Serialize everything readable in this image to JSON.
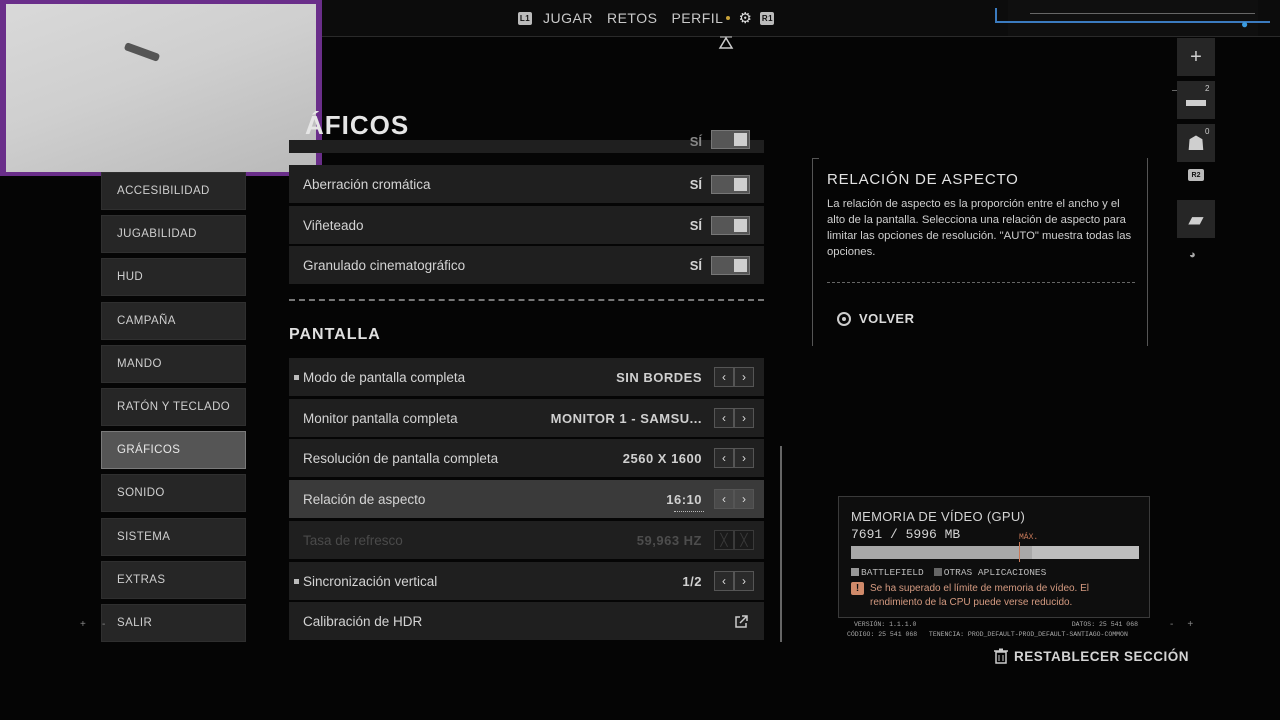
{
  "topnav": {
    "l1": "L1",
    "r1": "R1",
    "items": [
      "JUGAR",
      "RETOS",
      "PERFIL"
    ],
    "settings_icon": "gear-icon"
  },
  "page_title": "ÁFICOS",
  "left_menu": [
    {
      "label": "ACCESIBILIDAD",
      "active": false
    },
    {
      "label": "JUGABILIDAD",
      "active": false
    },
    {
      "label": "HUD",
      "active": false
    },
    {
      "label": "CAMPAÑA",
      "active": false
    },
    {
      "label": "MANDO",
      "active": false
    },
    {
      "label": "RATÓN Y TECLADO",
      "active": false
    },
    {
      "label": "GRÁFICOS",
      "active": true
    },
    {
      "label": "SONIDO",
      "active": false
    },
    {
      "label": "SISTEMA",
      "active": false
    },
    {
      "label": "EXTRAS",
      "active": false
    },
    {
      "label": "SALIR",
      "active": false
    }
  ],
  "effects_rows": [
    {
      "label": "Aberración cromática",
      "value": "SÍ"
    },
    {
      "label": "Viñeteado",
      "value": "SÍ"
    },
    {
      "label": "Granulado cinematográfico",
      "value": "SÍ"
    }
  ],
  "partial_row_value": "SÍ",
  "display_heading": "PANTALLA",
  "display_rows": [
    {
      "label": "Modo de pantalla completa",
      "value": "SIN BORDES"
    },
    {
      "label": "Monitor pantalla completa",
      "value": "MONITOR 1 - SAMSU..."
    },
    {
      "label": "Resolución de pantalla completa",
      "value": "2560 X 1600"
    },
    {
      "label": "Relación de aspecto",
      "value": "16:10"
    },
    {
      "label": "Tasa de refresco",
      "value": "59,963 HZ"
    },
    {
      "label": "Sincronización vertical",
      "value": "1/2"
    },
    {
      "label": "Calibración de HDR",
      "value": ""
    }
  ],
  "info": {
    "title": "RELACIÓN DE ASPECTO",
    "body": "La relación de aspecto es la proporción entre el ancho y el alto de la pantalla. Selecciona una relación de aspecto para limitar las opciones de resolución. \"AUTO\" muestra todas las opciones.",
    "back_label": "VOLVER"
  },
  "side_icons": {
    "badge_1": "2",
    "badge_2": "0",
    "r2": "R2"
  },
  "gpu": {
    "title": "MEMORIA DE VÍDEO (GPU)",
    "value": "7691 / 5996 MB",
    "max_label": "MÁX.",
    "max_fraction": 0.63,
    "legend_game": "BATTLEFIELD",
    "legend_other": "OTRAS APLICACIONES",
    "warning_icon": "!",
    "warning": "Se ha superado el límite de memoria de vídeo. El rendimiento de la CPU puede verse reducido."
  },
  "meta": {
    "version": "VERSIÓN: 1.1.1.0",
    "datos": "DATOS: 25 541 068",
    "codigo": "CÓDIGO: 25 541 068",
    "tenencia": "TENENCIA: PROD_DEFAULT-PROD_DEFAULT-SANTIAGO-COMMON"
  },
  "reset_label": "RESTABLECER SECCIÓN",
  "colors": {
    "accent_blue": "#3b7bbf",
    "webcam_border": "#6a2e8a",
    "warning": "#d08a6a"
  }
}
